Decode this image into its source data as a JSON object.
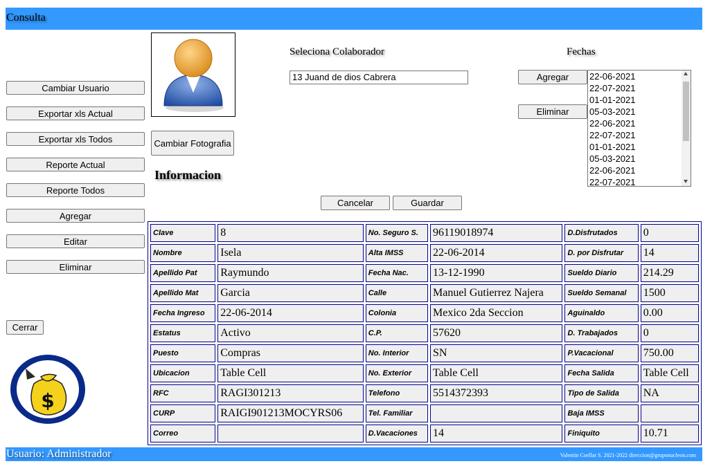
{
  "header": {
    "title": "Consulta"
  },
  "sidebar": {
    "buttons": [
      "Cambiar Usuario",
      "Exportar xls Actual",
      "Exportar xls Todos",
      "Reporte Actual",
      "Reporte Todos",
      "Agregar",
      "Editar",
      "Eliminar"
    ],
    "close_label": "Cerrar",
    "logo_icon": "money-bag-icon"
  },
  "photo": {
    "icon": "user-avatar-icon",
    "change_label": "Cambiar Fotografia"
  },
  "collaborator": {
    "label": "Seleciona Colaborador",
    "value": "13 Juand de dios Cabrera"
  },
  "dates": {
    "label": "Fechas",
    "add_label": "Agregar",
    "remove_label": "Eliminar",
    "items": [
      "22-06-2021",
      "22-07-2021",
      "01-01-2021",
      "05-03-2021",
      "22-06-2021",
      "22-07-2021",
      "01-01-2021",
      "05-03-2021",
      "22-06-2021",
      "22-07-2021"
    ]
  },
  "info_title": "Informacion",
  "actions": {
    "cancel_label": "Cancelar",
    "save_label": "Guardar"
  },
  "table": {
    "rows": [
      [
        "Clave",
        "8",
        "No. Seguro S.",
        "96119018974",
        "D.Disfrutados",
        "0"
      ],
      [
        "Nombre",
        "Isela",
        "Alta IMSS",
        "22-06-2014",
        "D. por Disfrutar",
        "14"
      ],
      [
        "Apellido Pat",
        "Raymundo",
        "Fecha Nac.",
        "13-12-1990",
        "Sueldo Diario",
        "214.29"
      ],
      [
        "Apellido Mat",
        "Garcia",
        "Calle",
        "Manuel Gutierrez Najera",
        "Sueldo Semanal",
        "1500"
      ],
      [
        "Fecha Ingreso",
        "22-06-2014",
        "Colonia",
        "Mexico 2da Seccion",
        "Aguinaldo",
        "0.00"
      ],
      [
        "Estatus",
        "Activo",
        "C.P.",
        "57620",
        "D. Trabajados",
        "0"
      ],
      [
        "Puesto",
        "Compras",
        "No. Interior",
        "SN",
        "P.Vacacional",
        "750.00"
      ],
      [
        "Ubicacion",
        "Table Cell",
        "No. Exterior",
        "Table Cell",
        "Fecha Salida",
        "Table Cell"
      ],
      [
        "RFC",
        "RAGI301213",
        "Telefono",
        "5514372393",
        "Tipo de Salida",
        "NA"
      ],
      [
        "CURP",
        "RAIGI901213MOCYRS06",
        "Tel. Familiar",
        "",
        "Baja IMSS",
        ""
      ],
      [
        "Correo",
        "",
        "D.Vacaciones",
        "14",
        "Finiquito",
        "10.71"
      ]
    ]
  },
  "footer": {
    "user": "Usuario: Administrador",
    "credit": "Valentin Coellar S. 2021-2022 direccion@gruponucleon.com"
  },
  "colors": {
    "bar": "#3399ff",
    "table_border": "#00008b",
    "cell_bg": "#efefef"
  }
}
